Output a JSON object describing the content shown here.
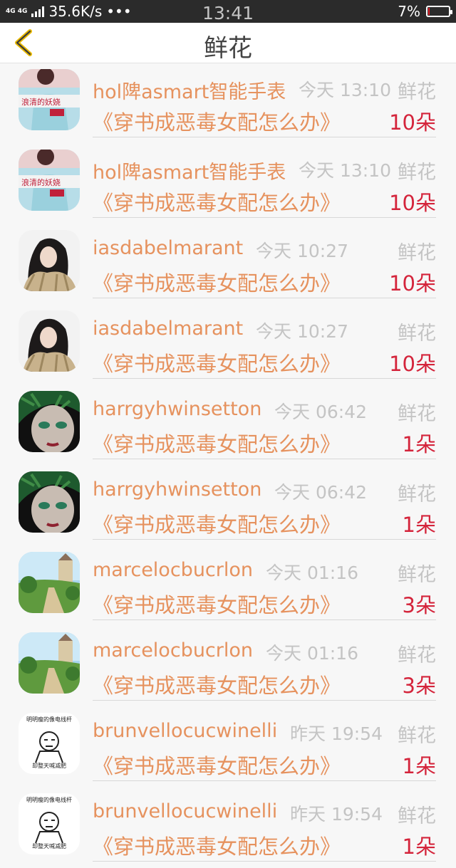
{
  "status_bar": {
    "network": "4G 4G",
    "speed": "35.6K/s",
    "dots": "•••",
    "time": "13:41",
    "battery_percent": "7%",
    "battery_level": 0.07
  },
  "header": {
    "title": "鲜花"
  },
  "records": [
    {
      "name": "hol陴asmart智能手表",
      "time": "今天 13:10",
      "type": "鲜花",
      "book": "《穿书成恶毒女配怎么办》",
      "count": "10朵",
      "avatar": "avatar-1"
    },
    {
      "name": "hol陴asmart智能手表",
      "time": "今天 13:10",
      "type": "鲜花",
      "book": "《穿书成恶毒女配怎么办》",
      "count": "10朵",
      "avatar": "avatar-1"
    },
    {
      "name": "iasdabelmarant",
      "time": "今天 10:27",
      "type": "鲜花",
      "book": "《穿书成恶毒女配怎么办》",
      "count": "10朵",
      "avatar": "avatar-2"
    },
    {
      "name": "iasdabelmarant",
      "time": "今天 10:27",
      "type": "鲜花",
      "book": "《穿书成恶毒女配怎么办》",
      "count": "10朵",
      "avatar": "avatar-2"
    },
    {
      "name": "harrgyhwinsetton",
      "time": "今天 06:42",
      "type": "鲜花",
      "book": "《穿书成恶毒女配怎么办》",
      "count": "1朵",
      "avatar": "avatar-3"
    },
    {
      "name": "harrgyhwinsetton",
      "time": "今天 06:42",
      "type": "鲜花",
      "book": "《穿书成恶毒女配怎么办》",
      "count": "1朵",
      "avatar": "avatar-3"
    },
    {
      "name": "marcelocbucrlon",
      "time": "今天 01:16",
      "type": "鲜花",
      "book": "《穿书成恶毒女配怎么办》",
      "count": "3朵",
      "avatar": "avatar-4"
    },
    {
      "name": "marcelocbucrlon",
      "time": "今天 01:16",
      "type": "鲜花",
      "book": "《穿书成恶毒女配怎么办》",
      "count": "3朵",
      "avatar": "avatar-4"
    },
    {
      "name": "brunvellocucwinelli",
      "time": "昨天 19:54",
      "type": "鲜花",
      "book": "《穿书成恶毒女配怎么办》",
      "count": "1朵",
      "avatar": "avatar-5",
      "avatar_text_top": "明明瘦的像电线杆",
      "avatar_text_bottom": "却整天喊减肥"
    },
    {
      "name": "brunvellocucwinelli",
      "time": "昨天 19:54",
      "type": "鲜花",
      "book": "《穿书成恶毒女配怎么办》",
      "count": "1朵",
      "avatar": "avatar-5",
      "avatar_text_top": "明明瘦的像电线杆",
      "avatar_text_bottom": "却整天喊减肥"
    }
  ]
}
